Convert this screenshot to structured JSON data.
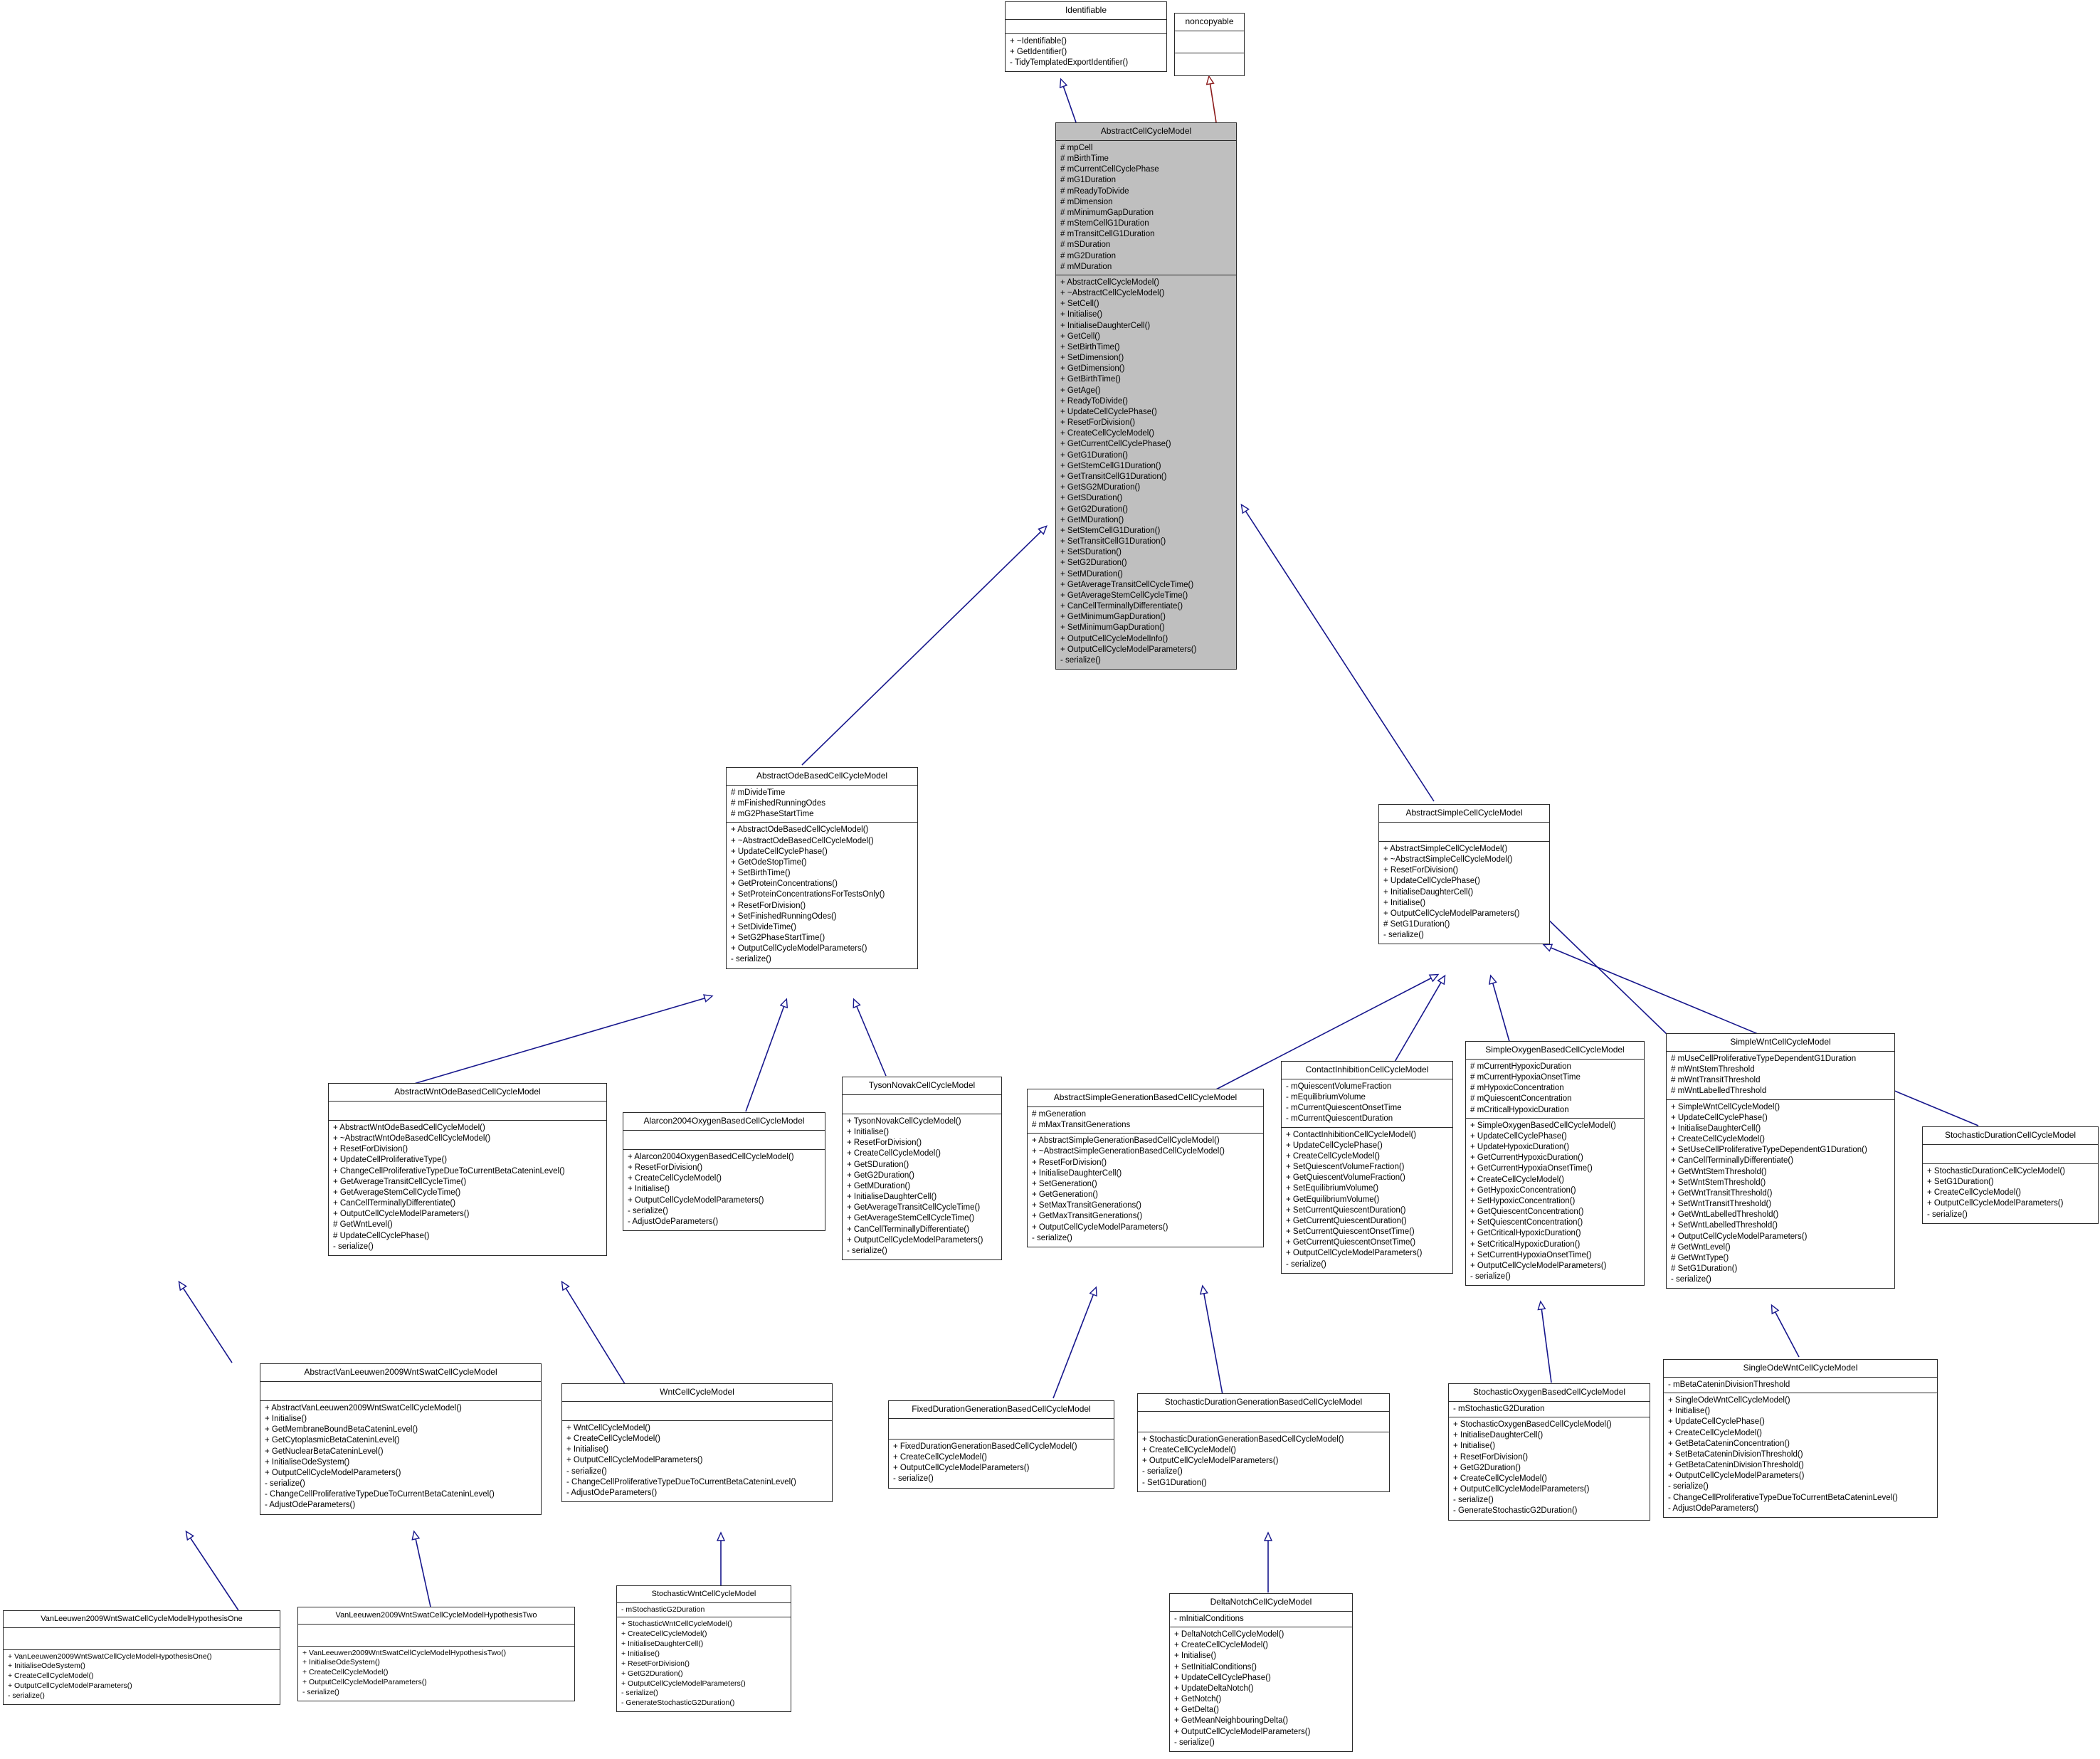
{
  "diagram": {
    "title": "AbstractCellCycleModel inheritance diagram",
    "colors": {
      "highlight_fill": "#bfbfbf",
      "inherit_edge": "#16168c",
      "usage_edge": "#8b1a1a",
      "border": "#2b2b2b"
    }
  },
  "classes": [
    {
      "id": "identifiable",
      "name": "Identifiable",
      "attributes": [],
      "operations": [
        "+ ~Identifiable()",
        "+ GetIdentifier()",
        "- TidyTemplatedExportIdentifier()"
      ]
    },
    {
      "id": "noncopyable",
      "name": "noncopyable",
      "attributes": [],
      "operations": []
    },
    {
      "id": "abstractcellcyclemodel",
      "name": "AbstractCellCycleModel",
      "attributes": [
        "# mpCell",
        "# mBirthTime",
        "# mCurrentCellCyclePhase",
        "# mG1Duration",
        "# mReadyToDivide",
        "# mDimension",
        "# mMinimumGapDuration",
        "# mStemCellG1Duration",
        "# mTransitCellG1Duration",
        "# mSDuration",
        "# mG2Duration",
        "# mMDuration"
      ],
      "operations": [
        "+ AbstractCellCycleModel()",
        "+ ~AbstractCellCycleModel()",
        "+ SetCell()",
        "+ Initialise()",
        "+ InitialiseDaughterCell()",
        "+ GetCell()",
        "+ SetBirthTime()",
        "+ SetDimension()",
        "+ GetDimension()",
        "+ GetBirthTime()",
        "+ GetAge()",
        "+ ReadyToDivide()",
        "+ UpdateCellCyclePhase()",
        "+ ResetForDivision()",
        "+ CreateCellCycleModel()",
        "+ GetCurrentCellCyclePhase()",
        "+ GetG1Duration()",
        "+ GetStemCellG1Duration()",
        "+ GetTransitCellG1Duration()",
        "+ GetSG2MDuration()",
        "+ GetSDuration()",
        "+ GetG2Duration()",
        "+ GetMDuration()",
        "+ SetStemCellG1Duration()",
        "+ SetTransitCellG1Duration()",
        "+ SetSDuration()",
        "+ SetG2Duration()",
        "+ SetMDuration()",
        "+ GetAverageTransitCellCycleTime()",
        "+ GetAverageStemCellCycleTime()",
        "+ CanCellTerminallyDifferentiate()",
        "+ GetMinimumGapDuration()",
        "+ SetMinimumGapDuration()",
        "+ OutputCellCycleModelInfo()",
        "+ OutputCellCycleModelParameters()",
        "- serialize()"
      ]
    },
    {
      "id": "abstractodebasedcellcyclemodel",
      "name": "AbstractOdeBasedCellCycleModel",
      "attributes": [
        "# mDivideTime",
        "# mFinishedRunningOdes",
        "# mG2PhaseStartTime"
      ],
      "operations": [
        "+ AbstractOdeBasedCellCycleModel()",
        "+ ~AbstractOdeBasedCellCycleModel()",
        "+ UpdateCellCyclePhase()",
        "+ GetOdeStopTime()",
        "+ SetBirthTime()",
        "+ GetProteinConcentrations()",
        "+ SetProteinConcentrationsForTestsOnly()",
        "+ ResetForDivision()",
        "+ SetFinishedRunningOdes()",
        "+ SetDivideTime()",
        "+ SetG2PhaseStartTime()",
        "+ OutputCellCycleModelParameters()",
        "- serialize()"
      ]
    },
    {
      "id": "abstractsimplecellcyclemodel",
      "name": "AbstractSimpleCellCycleModel",
      "attributes": [],
      "operations": [
        "+ AbstractSimpleCellCycleModel()",
        "+ ~AbstractSimpleCellCycleModel()",
        "+ ResetForDivision()",
        "+ UpdateCellCyclePhase()",
        "+ InitialiseDaughterCell()",
        "+ Initialise()",
        "+ OutputCellCycleModelParameters()",
        "# SetG1Duration()",
        "- serialize()"
      ]
    },
    {
      "id": "abstractwntodebasedcellcyclemodel",
      "name": "AbstractWntOdeBasedCellCycleModel",
      "attributes": [],
      "operations": [
        "+ AbstractWntOdeBasedCellCycleModel()",
        "+ ~AbstractWntOdeBasedCellCycleModel()",
        "+ ResetForDivision()",
        "+ UpdateCellProliferativeType()",
        "+ ChangeCellProliferativeTypeDueToCurrentBetaCateninLevel()",
        "+ GetAverageTransitCellCycleTime()",
        "+ GetAverageStemCellCycleTime()",
        "+ CanCellTerminallyDifferentiate()",
        "+ OutputCellCycleModelParameters()",
        "# GetWntLevel()",
        "# UpdateCellCyclePhase()",
        "- serialize()"
      ]
    },
    {
      "id": "alarcon2004oxygenbasedcellcyclemodel",
      "name": "Alarcon2004OxygenBasedCellCycleModel",
      "attributes": [],
      "operations": [
        "+ Alarcon2004OxygenBasedCellCycleModel()",
        "+ ResetForDivision()",
        "+ CreateCellCycleModel()",
        "+ Initialise()",
        "+ OutputCellCycleModelParameters()",
        "- serialize()",
        "- AdjustOdeParameters()"
      ]
    },
    {
      "id": "tysonnovakcellcyclemodel",
      "name": "TysonNovakCellCycleModel",
      "attributes": [],
      "operations": [
        "+ TysonNovakCellCycleModel()",
        "+ Initialise()",
        "+ ResetForDivision()",
        "+ CreateCellCycleModel()",
        "+ GetSDuration()",
        "+ GetG2Duration()",
        "+ GetMDuration()",
        "+ InitialiseDaughterCell()",
        "+ GetAverageTransitCellCycleTime()",
        "+ GetAverageStemCellCycleTime()",
        "+ CanCellTerminallyDifferentiate()",
        "+ OutputCellCycleModelParameters()",
        "- serialize()"
      ]
    },
    {
      "id": "abstractsimplegenerationbasedcellcyclemodel",
      "name": "AbstractSimpleGenerationBasedCellCycleModel",
      "attributes": [
        "# mGeneration",
        "# mMaxTransitGenerations"
      ],
      "operations": [
        "+ AbstractSimpleGenerationBasedCellCycleModel()",
        "+ ~AbstractSimpleGenerationBasedCellCycleModel()",
        "+ ResetForDivision()",
        "+ InitialiseDaughterCell()",
        "+ SetGeneration()",
        "+ GetGeneration()",
        "+ SetMaxTransitGenerations()",
        "+ GetMaxTransitGenerations()",
        "+ OutputCellCycleModelParameters()",
        "- serialize()"
      ]
    },
    {
      "id": "contactinhibitioncellcyclemodel",
      "name": "ContactInhibitionCellCycleModel",
      "attributes": [
        "- mQuiescentVolumeFraction",
        "- mEquilibriumVolume",
        "- mCurrentQuiescentOnsetTime",
        "- mCurrentQuiescentDuration"
      ],
      "operations": [
        "+ ContactInhibitionCellCycleModel()",
        "+ UpdateCellCyclePhase()",
        "+ CreateCellCycleModel()",
        "+ SetQuiescentVolumeFraction()",
        "+ GetQuiescentVolumeFraction()",
        "+ SetEquilibriumVolume()",
        "+ GetEquilibriumVolume()",
        "+ SetCurrentQuiescentDuration()",
        "+ GetCurrentQuiescentDuration()",
        "+ SetCurrentQuiescentOnsetTime()",
        "+ GetCurrentQuiescentOnsetTime()",
        "+ OutputCellCycleModelParameters()",
        "- serialize()"
      ]
    },
    {
      "id": "simpleoxygenbasedcellcyclemodel",
      "name": "SimpleOxygenBasedCellCycleModel",
      "attributes": [
        "# mCurrentHypoxicDuration",
        "# mCurrentHypoxiaOnsetTime",
        "# mHypoxicConcentration",
        "# mQuiescentConcentration",
        "# mCriticalHypoxicDuration"
      ],
      "operations": [
        "+ SimpleOxygenBasedCellCycleModel()",
        "+ UpdateCellCyclePhase()",
        "+ UpdateHypoxicDuration()",
        "+ GetCurrentHypoxicDuration()",
        "+ GetCurrentHypoxiaOnsetTime()",
        "+ CreateCellCycleModel()",
        "+ GetHypoxicConcentration()",
        "+ SetHypoxicConcentration()",
        "+ GetQuiescentConcentration()",
        "+ SetQuiescentConcentration()",
        "+ GetCriticalHypoxicDuration()",
        "+ SetCriticalHypoxicDuration()",
        "+ SetCurrentHypoxiaOnsetTime()",
        "+ OutputCellCycleModelParameters()",
        "- serialize()"
      ]
    },
    {
      "id": "simplewntcellcyclemodel",
      "name": "SimpleWntCellCycleModel",
      "attributes": [
        "# mUseCellProliferativeTypeDependentG1Duration",
        "# mWntStemThreshold",
        "# mWntTransitThreshold",
        "# mWntLabelledThreshold"
      ],
      "operations": [
        "+ SimpleWntCellCycleModel()",
        "+ UpdateCellCyclePhase()",
        "+ InitialiseDaughterCell()",
        "+ CreateCellCycleModel()",
        "+ SetUseCellProliferativeTypeDependentG1Duration()",
        "+ CanCellTerminallyDifferentiate()",
        "+ GetWntStemThreshold()",
        "+ SetWntStemThreshold()",
        "+ GetWntTransitThreshold()",
        "+ SetWntTransitThreshold()",
        "+ GetWntLabelledThreshold()",
        "+ SetWntLabelledThreshold()",
        "+ OutputCellCycleModelParameters()",
        "# GetWntLevel()",
        "# GetWntType()",
        "# SetG1Duration()",
        "- serialize()"
      ]
    },
    {
      "id": "stochasticdurationcellcyclemodel",
      "name": "StochasticDurationCellCycleModel",
      "attributes": [],
      "operations": [
        "+ StochasticDurationCellCycleModel()",
        "+ SetG1Duration()",
        "+ CreateCellCycleModel()",
        "+ OutputCellCycleModelParameters()",
        "- serialize()"
      ]
    },
    {
      "id": "abstractvanleeuwen2009wntswatcellcyclemodel",
      "name": "AbstractVanLeeuwen2009WntSwatCellCycleModel",
      "attributes": [],
      "operations": [
        "+ AbstractVanLeeuwen2009WntSwatCellCycleModel()",
        "+ Initialise()",
        "+ GetMembraneBoundBetaCateninLevel()",
        "+ GetCytoplasmicBetaCateninLevel()",
        "+ GetNuclearBetaCateninLevel()",
        "+ InitialiseOdeSystem()",
        "+ OutputCellCycleModelParameters()",
        "- serialize()",
        "- ChangeCellProliferativeTypeDueToCurrentBetaCateninLevel()",
        "- AdjustOdeParameters()"
      ]
    },
    {
      "id": "wntcellcyclemodel",
      "name": "WntCellCycleModel",
      "attributes": [],
      "operations": [
        "+ WntCellCycleModel()",
        "+ CreateCellCycleModel()",
        "+ Initialise()",
        "+ OutputCellCycleModelParameters()",
        "- serialize()",
        "- ChangeCellProliferativeTypeDueToCurrentBetaCateninLevel()",
        "- AdjustOdeParameters()"
      ]
    },
    {
      "id": "fixeddurationgenerationbasedcellcyclemodel",
      "name": "FixedDurationGenerationBasedCellCycleModel",
      "attributes": [],
      "operations": [
        "+ FixedDurationGenerationBasedCellCycleModel()",
        "+ CreateCellCycleModel()",
        "+ OutputCellCycleModelParameters()",
        "- serialize()"
      ]
    },
    {
      "id": "stochasticdurationgenerationbasedcellcyclemodel",
      "name": "StochasticDurationGenerationBasedCellCycleModel",
      "attributes": [],
      "operations": [
        "+ StochasticDurationGenerationBasedCellCycleModel()",
        "+ CreateCellCycleModel()",
        "+ OutputCellCycleModelParameters()",
        "- serialize()",
        "- SetG1Duration()"
      ]
    },
    {
      "id": "stochasticoxygenbasedcellcyclemodel",
      "name": "StochasticOxygenBasedCellCycleModel",
      "attributes": [
        "- mStochasticG2Duration"
      ],
      "operations": [
        "+ StochasticOxygenBasedCellCycleModel()",
        "+ InitialiseDaughterCell()",
        "+ Initialise()",
        "+ ResetForDivision()",
        "+ GetG2Duration()",
        "+ CreateCellCycleModel()",
        "+ OutputCellCycleModelParameters()",
        "- serialize()",
        "- GenerateStochasticG2Duration()"
      ]
    },
    {
      "id": "singleodewntcellcyclemodel",
      "name": "SingleOdeWntCellCycleModel",
      "attributes": [
        "- mBetaCateninDivisionThreshold"
      ],
      "operations": [
        "+ SingleOdeWntCellCycleModel()",
        "+ Initialise()",
        "+ UpdateCellCyclePhase()",
        "+ CreateCellCycleModel()",
        "+ GetBetaCateninConcentration()",
        "+ SetBetaCateninDivisionThreshold()",
        "+ GetBetaCateninDivisionThreshold()",
        "+ OutputCellCycleModelParameters()",
        "- serialize()",
        "- ChangeCellProliferativeTypeDueToCurrentBetaCateninLevel()",
        "- AdjustOdeParameters()"
      ]
    },
    {
      "id": "vanleeuwen2009wntswatcellcyclemodelhypothesisone",
      "name": "VanLeeuwen2009WntSwatCellCycleModelHypothesisOne",
      "attributes": [],
      "operations": [
        "+ VanLeeuwen2009WntSwatCellCycleModelHypothesisOne()",
        "+ InitialiseOdeSystem()",
        "+ CreateCellCycleModel()",
        "+ OutputCellCycleModelParameters()",
        "- serialize()"
      ]
    },
    {
      "id": "vanleeuwen2009wntswatcellcyclemodelhypothesistwo",
      "name": "VanLeeuwen2009WntSwatCellCycleModelHypothesisTwo",
      "attributes": [],
      "operations": [
        "+ VanLeeuwen2009WntSwatCellCycleModelHypothesisTwo()",
        "+ InitialiseOdeSystem()",
        "+ CreateCellCycleModel()",
        "+ OutputCellCycleModelParameters()",
        "- serialize()"
      ]
    },
    {
      "id": "stochasticwntcellcyclemodel",
      "name": "StochasticWntCellCycleModel",
      "attributes": [
        "- mStochasticG2Duration"
      ],
      "operations": [
        "+ StochasticWntCellCycleModel()",
        "+ CreateCellCycleModel()",
        "+ InitialiseDaughterCell()",
        "+ Initialise()",
        "+ ResetForDivision()",
        "+ GetG2Duration()",
        "+ OutputCellCycleModelParameters()",
        "- serialize()",
        "- GenerateStochasticG2Duration()"
      ]
    },
    {
      "id": "deltanotchcellcyclemodel",
      "name": "DeltaNotchCellCycleModel",
      "attributes": [
        "- mInitialConditions"
      ],
      "operations": [
        "+ DeltaNotchCellCycleModel()",
        "+ CreateCellCycleModel()",
        "+ Initialise()",
        "+ SetInitialConditions()",
        "+ UpdateCellCyclePhase()",
        "+ UpdateDeltaNotch()",
        "+ GetNotch()",
        "+ GetDelta()",
        "+ GetMeanNeighbouringDelta()",
        "+ OutputCellCycleModelParameters()",
        "- serialize()"
      ]
    }
  ]
}
